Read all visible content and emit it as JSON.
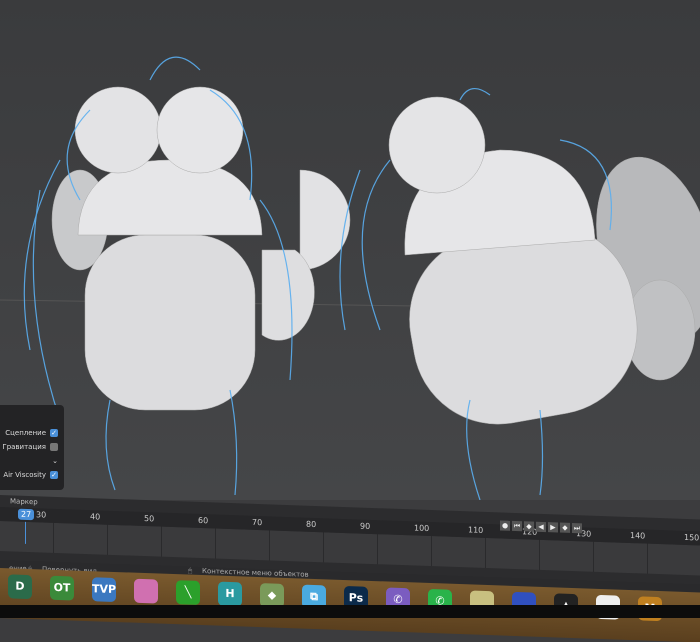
{
  "panel": {
    "items": [
      {
        "label": "Сцепление",
        "checked": true
      },
      {
        "label": "Гравитация",
        "checked": false
      },
      {
        "label": "",
        "dropdown": true
      },
      {
        "label": "Air Viscosity",
        "checked": true
      }
    ]
  },
  "timeline": {
    "marker_label": "Маркер",
    "current_frame": "27",
    "ticks": [
      "30",
      "40",
      "50",
      "60",
      "70",
      "80",
      "90",
      "100",
      "110",
      "120",
      "130",
      "140",
      "150"
    ]
  },
  "playback": {
    "icons": [
      "record-icon",
      "jump-start-icon",
      "prev-key-icon",
      "play-reverse-icon",
      "play-icon",
      "next-key-icon",
      "jump-end-icon"
    ],
    "glyphs": [
      "●",
      "⏮",
      "◆",
      "◀",
      "▶",
      "◆",
      "⏭"
    ]
  },
  "status": {
    "left": "…ение",
    "rotate": "Повернуть вид",
    "context": "Контекстное меню объектов"
  },
  "taskbar": {
    "apps": [
      {
        "name": "d-app",
        "text": "D",
        "color": "#2b6b4a"
      },
      {
        "name": "opentoonz",
        "text": "OT",
        "color": "#3a8a3a"
      },
      {
        "name": "tvpaint",
        "text": "TVP",
        "color": "#3b78c0"
      },
      {
        "name": "disc-app",
        "text": "",
        "color": "#d070b0"
      },
      {
        "name": "green-app",
        "text": "╲",
        "color": "#2ba02b"
      },
      {
        "name": "h-app",
        "text": "H",
        "color": "#2a9aa0"
      },
      {
        "name": "krita-like",
        "text": "◆",
        "color": "#7a9a5a"
      },
      {
        "name": "blue-app",
        "text": "⧉",
        "color": "#4aaae0"
      },
      {
        "name": "photoshop",
        "text": "Ps",
        "color": "#0b2a4a"
      },
      {
        "name": "viber",
        "text": "✆",
        "color": "#7b5cc0"
      },
      {
        "name": "whatsapp",
        "text": "✆",
        "color": "#29b34a"
      },
      {
        "name": "leaf-app",
        "text": "",
        "color": "#c8c080"
      },
      {
        "name": "blue-globe",
        "text": "",
        "color": "#3050c0"
      },
      {
        "name": "fire-app",
        "text": "▲",
        "color": "#222"
      },
      {
        "name": "bw-app",
        "text": "",
        "color": "#eee"
      },
      {
        "name": "m-app",
        "text": "M",
        "color": "#c08020"
      }
    ]
  }
}
